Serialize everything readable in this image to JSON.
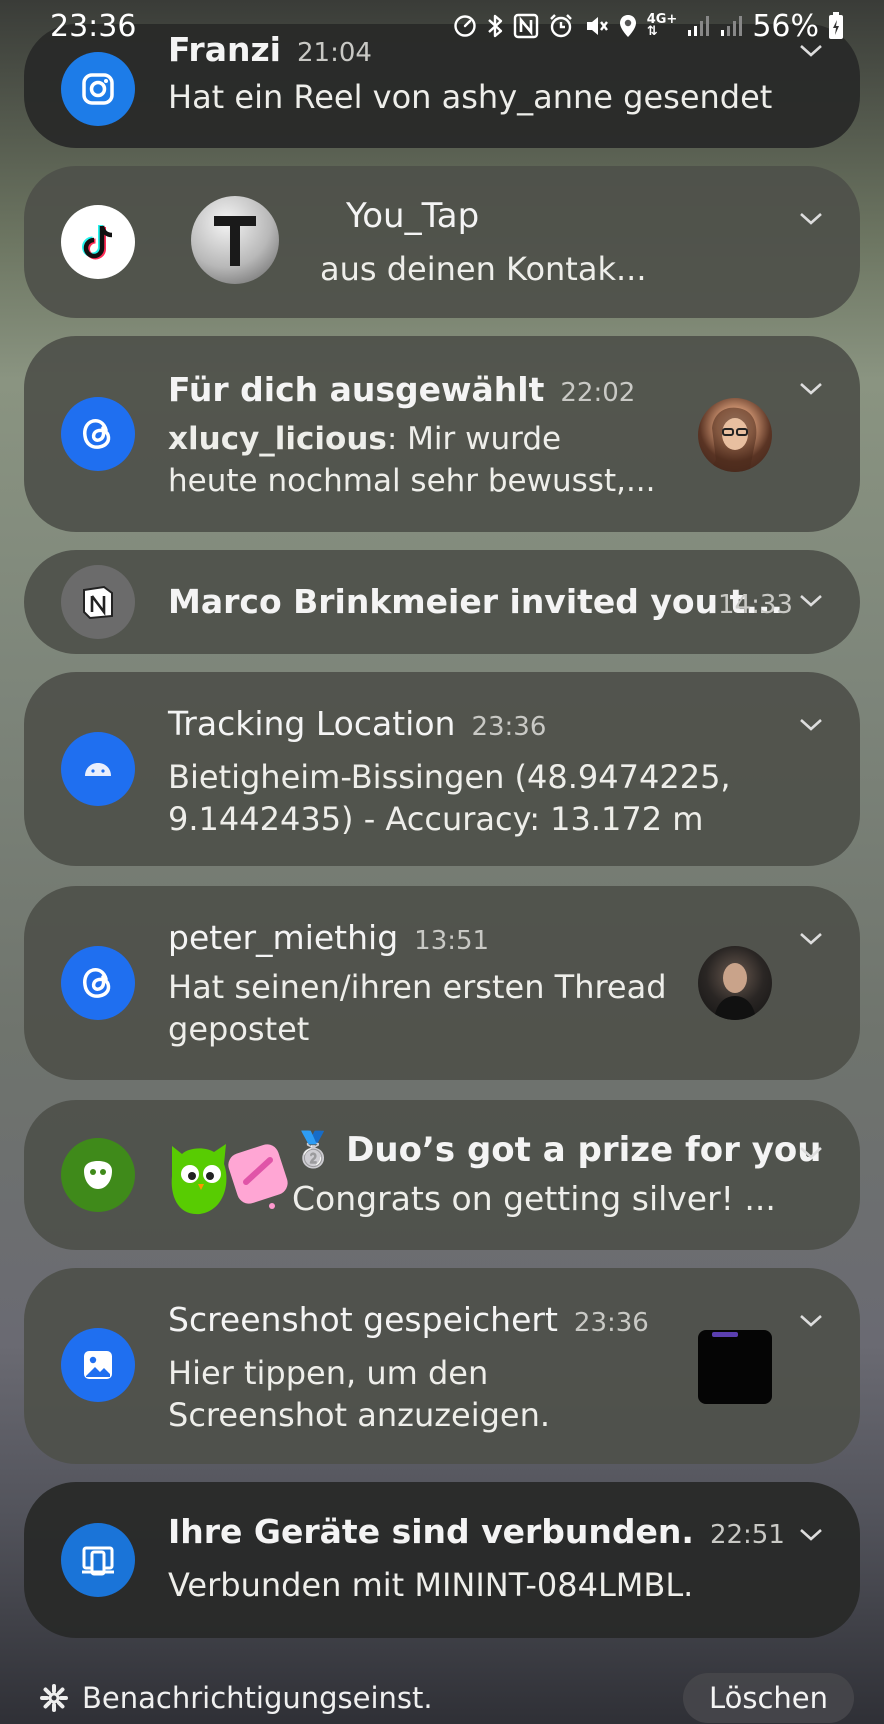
{
  "status_bar": {
    "time": "23:36",
    "battery": "56%",
    "icons": [
      "speedometer-icon",
      "bluetooth-icon",
      "nfc-icon",
      "alarm-icon",
      "mute-icon",
      "location-icon",
      "4g-icon",
      "signal-icon",
      "signal-icon",
      "battery-icon"
    ]
  },
  "notifications": [
    {
      "app": "Instagram",
      "icon": "instagram-icon",
      "title": "Franzi",
      "time": "21:04",
      "body": "Hat ein Reel von ashy_anne gesendet"
    },
    {
      "app": "TikTok",
      "icon": "tiktok-icon",
      "title": "You_Tap",
      "body": "aus deinen Kontak..."
    },
    {
      "app": "Threads",
      "icon": "threads-icon",
      "title": "Für dich ausgewählt",
      "time": "22:02",
      "body_bold": "xlucy_licious",
      "body": ": Mir wurde",
      "body_line2": "heute nochmal sehr bewusst,..."
    },
    {
      "app": "Notion",
      "icon": "notion-icon",
      "title": "Marco Brinkmeier invited you t...",
      "time": "14:33"
    },
    {
      "app": "Android",
      "icon": "android-icon",
      "title": "Tracking Location",
      "time": "23:36",
      "body": "Bietigheim-Bissingen (48.9474225,",
      "body_line2": "9.1442435) - Accuracy: 13.172 m"
    },
    {
      "app": "Threads",
      "icon": "threads-icon",
      "title": "peter_miethig",
      "time": "13:51",
      "body": "Hat seinen/ihren ersten Thread",
      "body_line2": "gepostet"
    },
    {
      "app": "Duolingo",
      "icon": "duolingo-icon",
      "title": "🥈 Duo’s got a prize for you",
      "body": "Congrats on getting silver! ..."
    },
    {
      "app": "Gallery",
      "icon": "gallery-icon",
      "title": "Screenshot gespeichert",
      "time": "23:36",
      "body": "Hier tippen, um den",
      "body_line2": "Screenshot anzuzeigen."
    },
    {
      "app": "Link to Windows",
      "icon": "devices-icon",
      "title": "Ihre Geräte sind verbunden.",
      "time": "22:51",
      "body": "Verbunden mit MININT-084LMBL."
    }
  ],
  "footer": {
    "settings_label": "Benachrichtigungseinst.",
    "clear_label": "Löschen"
  },
  "colors": {
    "threads_blue": "#1f6ff0",
    "duolingo_green": "#3f8a1a",
    "notion_gray": "#6b6b6b"
  }
}
